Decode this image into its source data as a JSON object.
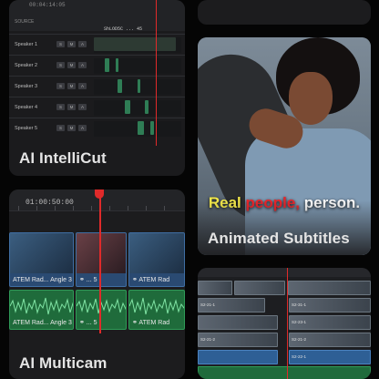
{
  "intellicut": {
    "title": "AI IntelliCut",
    "timecode": "00:04:14:05",
    "source_label": "SOURCE",
    "clip_name": "ShLOD5C ... 45",
    "speakers": [
      "Speaker 1",
      "Speaker 2",
      "Speaker 3",
      "Speaker 4",
      "Speaker 5"
    ],
    "buttons": [
      "S",
      "M",
      "A"
    ]
  },
  "subtitles": {
    "title": "Animated Subtitles",
    "caption_words": [
      "Real",
      "people,",
      "person."
    ],
    "colors": {
      "word1": "#f3e84a",
      "word2": "#e8252a",
      "word3": "#f7f7f7"
    }
  },
  "multicam": {
    "title": "AI Multicam",
    "timecode": "01:00:50:00",
    "video_clips": [
      {
        "label": "ATEM Rad... Angle 3"
      },
      {
        "label": "⚭ ... 5"
      },
      {
        "label": "⚭ ATEM Rad"
      }
    ],
    "audio_clips": [
      {
        "label": "ATEM Rad... Angle 3"
      },
      {
        "label": "⚭ ... 5"
      },
      {
        "label": "⚭ ATEM Rad"
      }
    ]
  },
  "timeline": {
    "clip_labels": [
      "S2-31-1",
      "S2-21-1",
      "S2-21-2",
      "S2-23-1",
      "S2-21-2",
      "S2-22-1"
    ]
  },
  "colors": {
    "accent_red": "#e02a2a",
    "audio_green": "#1f6b3b",
    "video_blue": "#2a4a72"
  }
}
